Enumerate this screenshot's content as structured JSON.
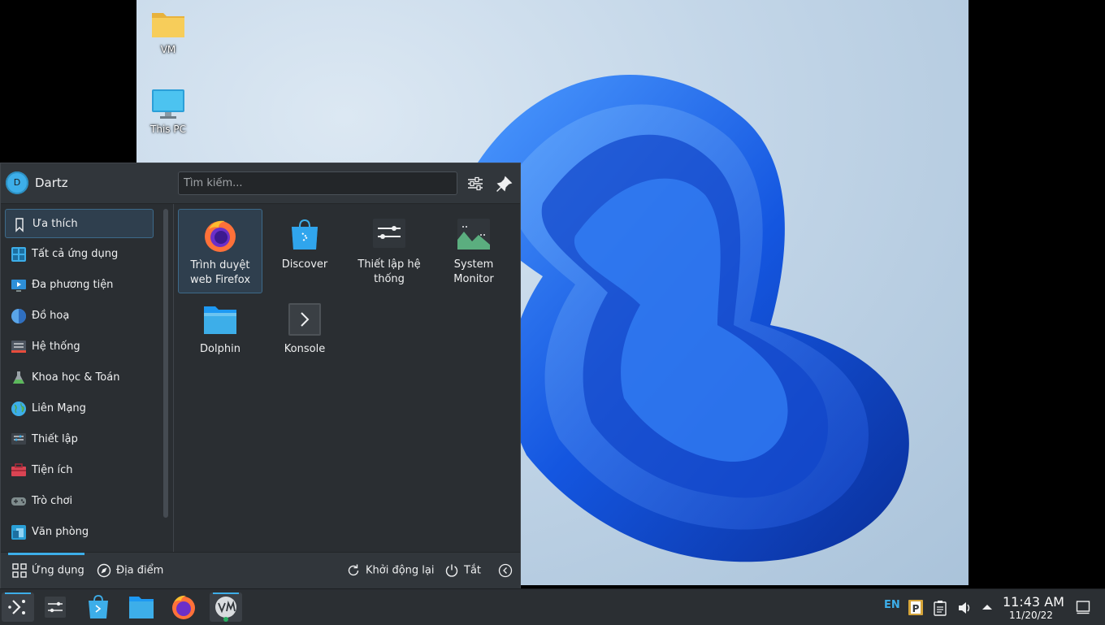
{
  "desktop": {
    "icons": [
      {
        "label": "VM",
        "icon": "folder-icon"
      },
      {
        "label": "This PC",
        "icon": "computer-icon"
      }
    ]
  },
  "launcher": {
    "user": {
      "initial": "D",
      "name": "Dartz"
    },
    "search": {
      "placeholder": "Tìm kiếm...",
      "value": ""
    },
    "header_buttons": [
      "configure-icon",
      "pin-icon"
    ],
    "categories": [
      {
        "label": "Ưa thích",
        "icon": "bookmark-icon",
        "selected": true
      },
      {
        "label": "Tất cả ứng dụng",
        "icon": "all-apps-icon"
      },
      {
        "label": "Đa phương tiện",
        "icon": "multimedia-icon"
      },
      {
        "label": "Đồ hoạ",
        "icon": "graphics-icon"
      },
      {
        "label": "Hệ thống",
        "icon": "system-icon"
      },
      {
        "label": "Khoa học & Toán",
        "icon": "science-icon"
      },
      {
        "label": "Liên Mạng",
        "icon": "internet-icon"
      },
      {
        "label": "Thiết lập",
        "icon": "settings-icon"
      },
      {
        "label": "Tiện ích",
        "icon": "utilities-icon"
      },
      {
        "label": "Trò chơi",
        "icon": "games-icon"
      },
      {
        "label": "Văn phòng",
        "icon": "office-icon"
      }
    ],
    "apps": [
      {
        "line1": "Trình duyệt",
        "line2": "web Firefox",
        "icon": "firefox-icon",
        "selected": true
      },
      {
        "line1": "Discover",
        "line2": "",
        "icon": "discover-icon"
      },
      {
        "line1": "Thiết lập hệ",
        "line2": "thống",
        "icon": "system-settings-icon"
      },
      {
        "line1": "System",
        "line2": "Monitor",
        "icon": "system-monitor-icon"
      },
      {
        "line1": "Dolphin",
        "line2": "",
        "icon": "dolphin-icon"
      },
      {
        "line1": "Konsole",
        "line2": "",
        "icon": "konsole-icon"
      }
    ],
    "footer": {
      "apps_tab": "Ứng dụng",
      "places_tab": "Địa điểm",
      "restart": "Khởi động lại",
      "shutdown": "Tắt"
    }
  },
  "panel": {
    "tasks": [
      "application-launcher-icon",
      "system-settings-icon",
      "discover-icon",
      "dolphin-icon",
      "firefox-icon",
      "vm-icon"
    ],
    "tray": {
      "language": "EN",
      "clock_time": "11:43 AM",
      "clock_date": "11/20/22"
    }
  },
  "colors": {
    "accent": "#3daee9",
    "menu_bg": "#2a2e32",
    "panel_bg": "#2b2f33",
    "wallpaper_ribbon": "#1a5fe0"
  }
}
